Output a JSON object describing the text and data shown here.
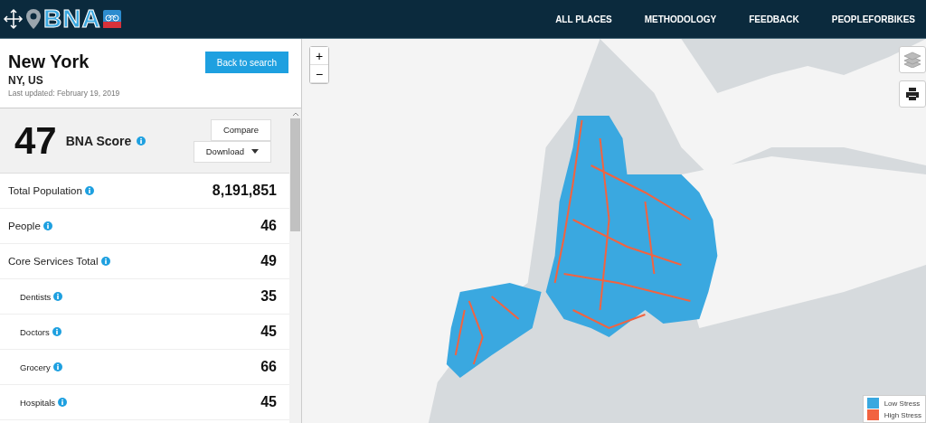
{
  "header": {
    "logo": "BNA",
    "nav": [
      "ALL PLACES",
      "METHODOLOGY",
      "FEEDBACK",
      "PEOPLEFORBIKES"
    ]
  },
  "place": {
    "city": "New York",
    "region": "NY, US",
    "updated": "Last updated: February 19, 2019",
    "back_button": "Back to search"
  },
  "score": {
    "value": "47",
    "label": "BNA Score",
    "compare_button": "Compare",
    "download_button": "Download"
  },
  "metrics": [
    {
      "label": "Total Population",
      "value": "8,191,851",
      "kind": "main"
    },
    {
      "label": "People",
      "value": "46",
      "kind": "main"
    },
    {
      "label": "Core Services Total",
      "value": "49",
      "kind": "main"
    },
    {
      "label": "Dentists",
      "value": "35",
      "kind": "sub"
    },
    {
      "label": "Doctors",
      "value": "45",
      "kind": "sub"
    },
    {
      "label": "Grocery",
      "value": "66",
      "kind": "sub"
    },
    {
      "label": "Hospitals",
      "value": "45",
      "kind": "sub"
    }
  ],
  "map": {
    "zoom_in": "+",
    "zoom_out": "−",
    "legend": [
      {
        "label": "Low Stress",
        "color": "#3aa8e0"
      },
      {
        "label": "High Stress",
        "color": "#f26340"
      }
    ]
  }
}
